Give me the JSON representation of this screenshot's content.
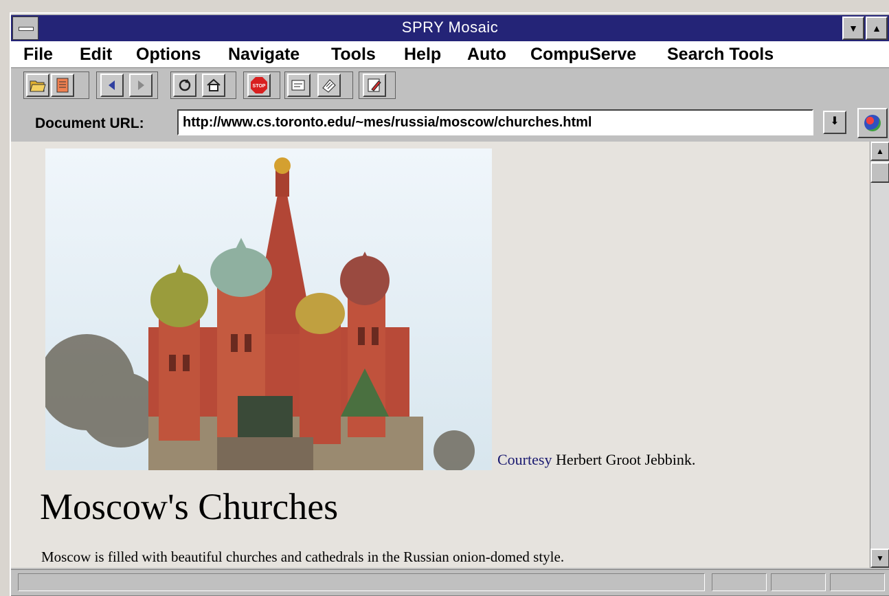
{
  "window": {
    "title": "SPRY Mosaic"
  },
  "menu": [
    {
      "label": "File"
    },
    {
      "label": "Edit"
    },
    {
      "label": "Options"
    },
    {
      "label": "Navigate"
    },
    {
      "label": "Tools"
    },
    {
      "label": "Help"
    },
    {
      "label": "Auto"
    },
    {
      "label": "CompuServe"
    },
    {
      "label": "Search Tools"
    }
  ],
  "toolbar": {
    "icons": [
      "open-folder-icon",
      "notepad-icon",
      "back-arrow-icon",
      "forward-arrow-icon",
      "reload-icon",
      "home-icon",
      "stop-icon",
      "hotlist-icon",
      "news-icon",
      "edit-icon"
    ]
  },
  "address": {
    "label": "Document URL:",
    "url": "http://www.cs.toronto.edu/~mes/russia/moscow/churches.html"
  },
  "page": {
    "caption_link": "Courtesy",
    "caption_text": " Herbert Groot Jebbink.",
    "heading": "Moscow's Churches",
    "paragraph": "Moscow is filled with beautiful churches and cathedrals in the Russian onion-domed style."
  },
  "colors": {
    "titlebar": "#242477",
    "link": "#1a1a70",
    "chrome": "#c0c0c0"
  }
}
